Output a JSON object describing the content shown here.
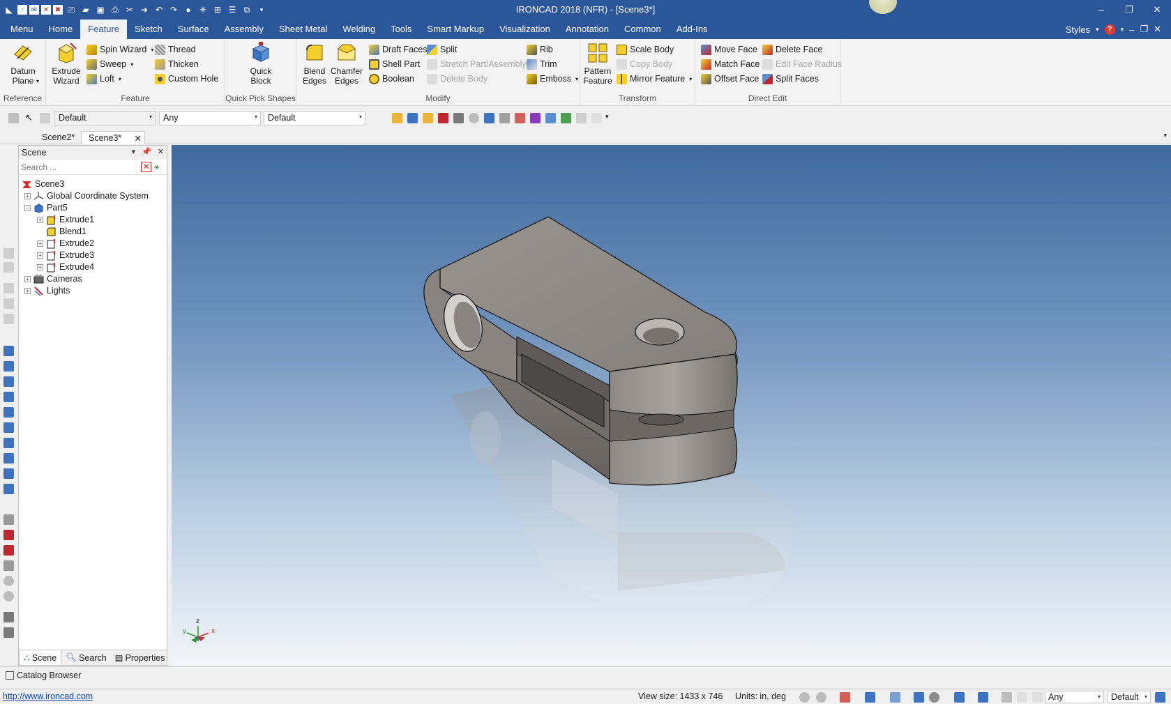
{
  "window": {
    "title": "IRONCAD 2018 (NFR) - [Scene3*]",
    "minimize": "–",
    "restore": "❐",
    "close": "✕"
  },
  "ribbon_tabs": [
    "Menu",
    "Home",
    "Feature",
    "Sketch",
    "Surface",
    "Assembly",
    "Sheet Metal",
    "Welding",
    "Tools",
    "Smart Markup",
    "Visualization",
    "Annotation",
    "Common",
    "Add-Ins"
  ],
  "ribbon_right": {
    "styles": "Styles",
    "help": "?"
  },
  "groups": {
    "reference": {
      "label": "Reference",
      "datum_plane": "Datum\nPlane"
    },
    "feature": {
      "label": "Feature",
      "extrude_wizard": "Extrude\nWizard",
      "spin_wizard": "Spin Wizard",
      "sweep": "Sweep",
      "loft": "Loft",
      "thread": "Thread",
      "thicken": "Thicken",
      "custom_hole": "Custom Hole"
    },
    "quick_pick": {
      "label": "Quick Pick Shapes",
      "quick_block": "Quick\nBlock"
    },
    "modify": {
      "label": "Modify",
      "blend_edges": "Blend\nEdges",
      "chamfer_edges": "Chamfer\nEdges",
      "draft_faces": "Draft Faces",
      "shell_part": "Shell Part",
      "boolean": "Boolean",
      "split": "Split",
      "stretch": "Stretch Part/Assembly",
      "delete_body": "Delete Body",
      "rib": "Rib",
      "trim": "Trim",
      "emboss": "Emboss"
    },
    "transform": {
      "label": "Transform",
      "pattern_feature": "Pattern\nFeature",
      "scale_body": "Scale Body",
      "copy_body": "Copy Body",
      "mirror_feature": "Mirror Feature"
    },
    "direct_edit": {
      "label": "Direct Edit",
      "move_face": "Move Face",
      "match_face": "Match Face",
      "offset_face": "Offset Face",
      "delete_face": "Delete Face",
      "edit_face_radius": "Edit Face Radius",
      "split_faces": "Split Faces"
    }
  },
  "toolbar": {
    "combo1": "Default",
    "combo2": "Any",
    "combo3": "Default"
  },
  "doc_tabs": [
    "Scene2*",
    "Scene3*"
  ],
  "scene_panel": {
    "title": "Scene",
    "search_placeholder": "Search ...",
    "tree": {
      "scene3": "Scene3",
      "global_cs": "Global Coordinate System",
      "part5": "Part5",
      "extrude1": "Extrude1",
      "blend1": "Blend1",
      "extrude2": "Extrude2",
      "extrude3": "Extrude3",
      "extrude4": "Extrude4",
      "cameras": "Cameras",
      "lights": "Lights"
    },
    "bottom_tabs": [
      "Scene",
      "Search",
      "Properties"
    ]
  },
  "catalog_browser": "Catalog Browser",
  "status": {
    "url": "http://www.ironcad.com",
    "view_size": "View size: 1433 x  746",
    "units": "Units: in, deg",
    "combo_any": "Any",
    "combo_default": "Default"
  },
  "triad": {
    "x": "x",
    "y": "y",
    "z": "z"
  },
  "colors": {
    "title_bar": "#2b579a",
    "ribbon_bg": "#f3f3f3",
    "part_gray": "#8f8985",
    "viewport_top": "#3f6a9e",
    "viewport_bottom": "#f2f5f9"
  }
}
